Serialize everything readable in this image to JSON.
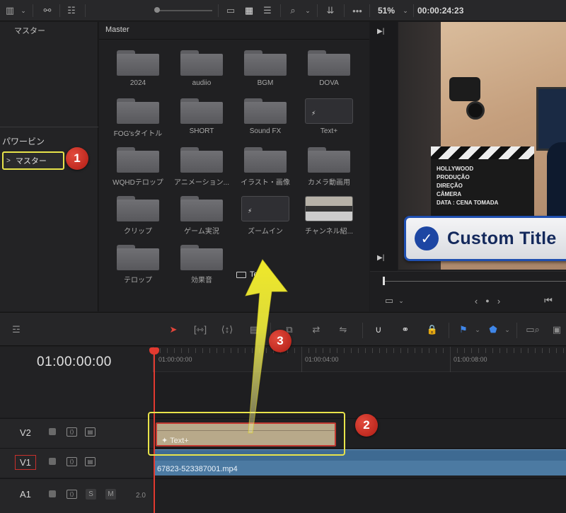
{
  "topbar": {
    "zoom_percent": "51%",
    "timecode": "00:00:24:23"
  },
  "bins": {
    "master_top": "マスター",
    "power_bin": "パワービン",
    "master_item": "マスター"
  },
  "media_pool": {
    "title": "Master",
    "items": [
      {
        "label": "2024",
        "kind": "folder"
      },
      {
        "label": "audiio",
        "kind": "folder"
      },
      {
        "label": "BGM",
        "kind": "folder"
      },
      {
        "label": "DOVA",
        "kind": "folder"
      },
      {
        "label": "FOG'sタイトル",
        "kind": "folder"
      },
      {
        "label": "SHORT",
        "kind": "folder"
      },
      {
        "label": "Sound FX",
        "kind": "folder"
      },
      {
        "label": "Text+",
        "kind": "fusion-title"
      },
      {
        "label": "WQHDテロップ",
        "kind": "folder"
      },
      {
        "label": "アニメーション...",
        "kind": "folder"
      },
      {
        "label": "イラスト・画像",
        "kind": "folder"
      },
      {
        "label": "カメラ動画用",
        "kind": "folder"
      },
      {
        "label": "クリップ",
        "kind": "folder"
      },
      {
        "label": "ゲーム実況",
        "kind": "folder"
      },
      {
        "label": "ズームイン",
        "kind": "fusion-title"
      },
      {
        "label": "チャンネル紹...",
        "kind": "video"
      },
      {
        "label": "テロップ",
        "kind": "folder"
      },
      {
        "label": "効果音",
        "kind": "folder"
      }
    ],
    "drag_label": "Te"
  },
  "viewer": {
    "custom_title": "Custom Title",
    "clapper_lines": [
      "HOLLYWOOD",
      "PRODUÇÃO",
      "DIREÇÃO",
      "CÂMERA",
      "DATA : CENA   TOMADA"
    ]
  },
  "timeline": {
    "timecode": "01:00:00:00",
    "ruler_labels": [
      "01:00:00:00",
      "01:00:04:00",
      "01:00:08:00"
    ],
    "tracks": {
      "v2": "V2",
      "v1": "V1",
      "a1": "A1",
      "a1_volume": "2.0",
      "solo": "S",
      "mute": "M"
    },
    "clip_text": "Text+",
    "clip_video": "67823-523387001.mp4"
  },
  "annotations": {
    "badge_1": "1",
    "badge_2": "2",
    "badge_3": "3"
  },
  "colors": {
    "highlight": "#e8e34a",
    "badge": "#c8241c",
    "playhead": "#e23a30",
    "title_clip": "#b8a98a",
    "video_clip": "#4c7aa2"
  }
}
